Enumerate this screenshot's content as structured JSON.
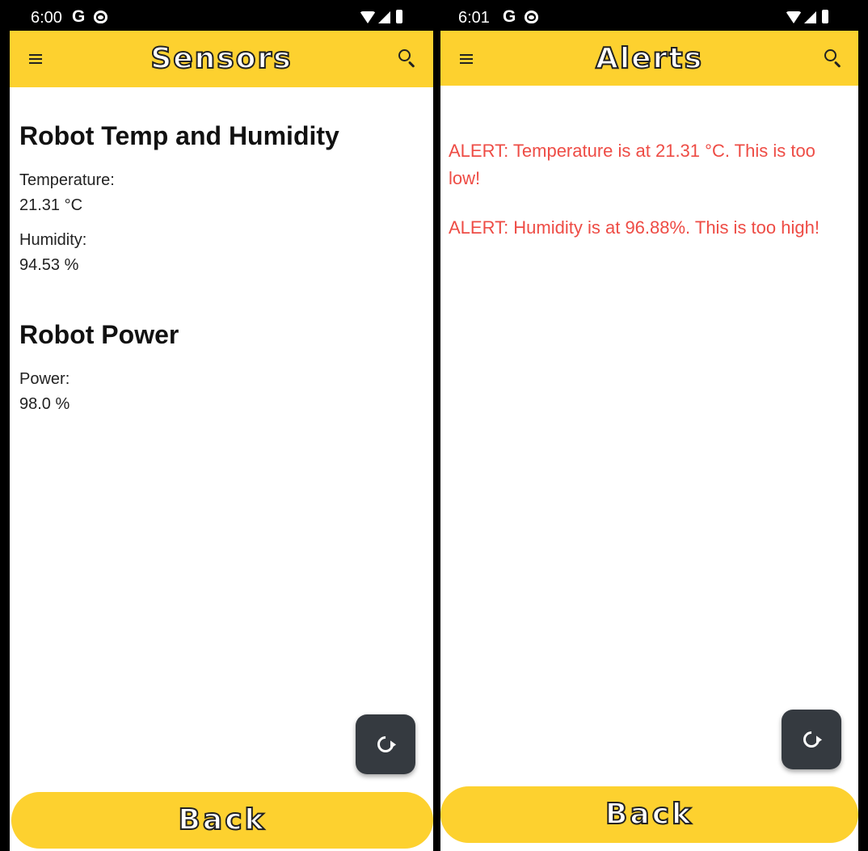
{
  "left_screen": {
    "status_bar": {
      "time": "6:00",
      "google_icon": "G"
    },
    "app_bar": {
      "title": "Sensors",
      "menu_icon": "menu-icon",
      "search_icon": "search-icon"
    },
    "sections": [
      {
        "title": "Robot Temp and Humidity",
        "fields": [
          {
            "label": "Temperature:",
            "value": "21.31 °C"
          },
          {
            "label": "Humidity:",
            "value": "94.53 %"
          }
        ]
      },
      {
        "title": "Robot Power",
        "fields": [
          {
            "label": "Power:",
            "value": "98.0 %"
          }
        ]
      }
    ],
    "fab_icon": "refresh-icon",
    "back_label": "Back"
  },
  "right_screen": {
    "status_bar": {
      "time": "6:01",
      "google_icon": "G"
    },
    "app_bar": {
      "title": "Alerts",
      "menu_icon": "menu-icon",
      "search_icon": "search-icon"
    },
    "alerts": [
      "ALERT: Temperature is at 21.31 °C. This is too low!",
      "ALERT: Humidity is at 96.88%. This is too high!"
    ],
    "fab_icon": "refresh-icon",
    "back_label": "Back"
  },
  "colors": {
    "accent": "#fdd12f",
    "alert_text": "#ee4c45",
    "fab_background": "#353a40"
  }
}
